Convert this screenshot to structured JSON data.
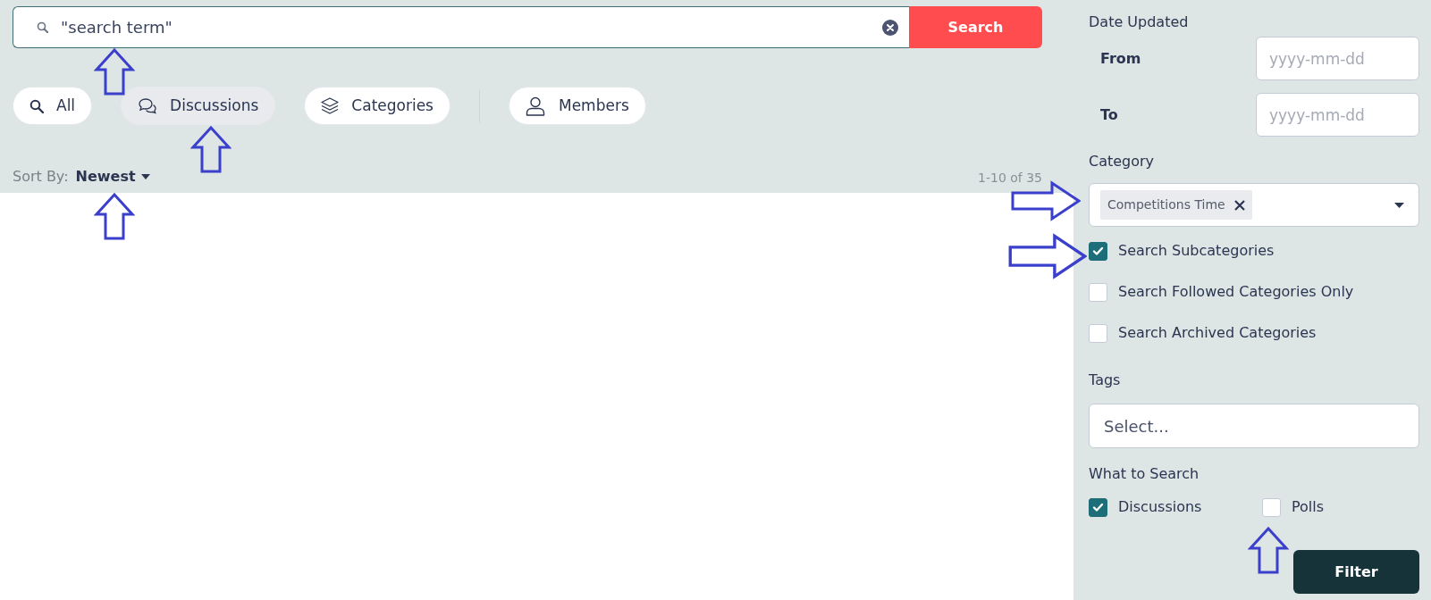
{
  "search": {
    "value": "\"search term\"",
    "button": "Search"
  },
  "tabs": [
    {
      "label": "All",
      "kind": "search",
      "selected": false
    },
    {
      "label": "Discussions",
      "kind": "chat",
      "selected": true
    },
    {
      "label": "Categories",
      "kind": "layers",
      "selected": false
    },
    {
      "label": "Members",
      "kind": "person",
      "selected": false
    }
  ],
  "sort": {
    "label": "Sort By:",
    "value": "Newest"
  },
  "result_count": "1-10 of 35",
  "filters": {
    "date_updated": {
      "title": "Date Updated",
      "fields": [
        {
          "label": "From",
          "placeholder": "yyyy-mm-dd"
        },
        {
          "label": "To",
          "placeholder": "yyyy-mm-dd"
        }
      ]
    },
    "category": {
      "title": "Category",
      "tokens": [
        "Competitions Time"
      ],
      "options": [
        {
          "label": "Search Subcategories",
          "checked": true
        },
        {
          "label": "Search Followed Categories Only",
          "checked": false
        },
        {
          "label": "Search Archived Categories",
          "checked": false
        }
      ]
    },
    "tags": {
      "title": "Tags",
      "placeholder": "Select..."
    },
    "what_to_search": {
      "title": "What to Search",
      "options": [
        {
          "label": "Discussions",
          "checked": true
        },
        {
          "label": "Polls",
          "checked": false
        }
      ]
    },
    "button": "Filter"
  }
}
